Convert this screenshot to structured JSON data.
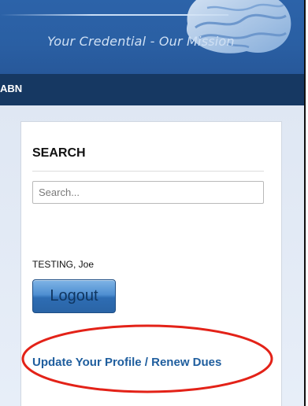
{
  "header": {
    "tagline": "Your Credential - Our Mission"
  },
  "nav": {
    "item": "ABN"
  },
  "search": {
    "title": "SEARCH",
    "placeholder": "Search..."
  },
  "user": {
    "name": "TESTING, Joe",
    "logout_label": "Logout"
  },
  "links": {
    "profile": "Update Your Profile / Renew Dues"
  },
  "colors": {
    "header_blue": "#2c63a9",
    "nav_navy": "#163862",
    "link_blue": "#1f5e9e",
    "highlight_red": "#e32218"
  }
}
